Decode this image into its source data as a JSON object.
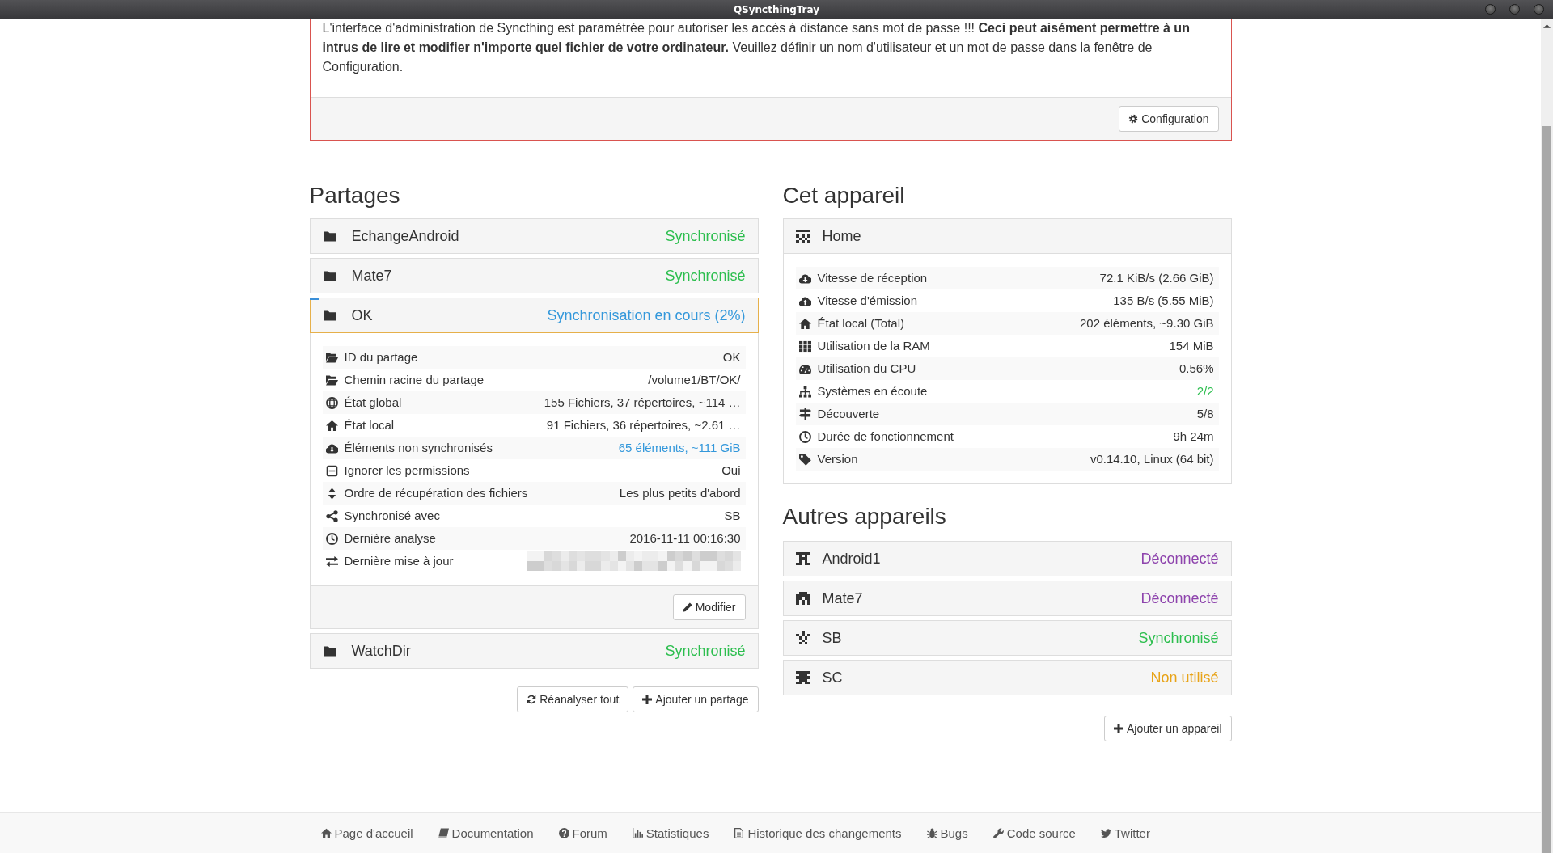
{
  "window": {
    "title": "QSyncthingTray"
  },
  "warning": {
    "message": "L'interface d'administration de Syncthing est paramétrée pour autoriser les accès à distance sans mot de passe !!! **Ceci peut aisément permettre à un intrus de lire et modifier n'importe quel fichier de votre ordinateur.** Veuillez définir un nom d'utilisateur et un mot de passe dans la fenêtre de Configuration.",
    "button": "Configuration"
  },
  "folders": {
    "title": "Partages",
    "items": [
      {
        "name": "EchangeAndroid",
        "status": "Synchronisé",
        "color": "#2cbe4e",
        "expanded": false
      },
      {
        "name": "Mate7",
        "status": "Synchronisé",
        "color": "#2cbe4e",
        "expanded": false
      },
      {
        "name": "OK",
        "status": "Synchronisation en cours (2%)",
        "color": "#3498db",
        "expanded": true,
        "level": 0.02,
        "details": [
          {
            "kind": "text",
            "label": "ID du partage",
            "value": "OK",
            "color": "#333333"
          },
          {
            "kind": "text",
            "label": "Chemin racine du partage",
            "value": "/volume1/BT/OK/",
            "color": "#333333"
          },
          {
            "kind": "text",
            "label": "État global",
            "value": "155 Fichiers, 37 répertoires, ~114 …",
            "color": "#333333"
          },
          {
            "kind": "text",
            "label": "État local",
            "value": "91 Fichiers, 36 répertoires, ~2.61 …",
            "color": "#333333"
          },
          {
            "kind": "link",
            "label": "Éléments non synchronisés",
            "value": "65 éléments, ~111 GiB",
            "color": "#3498db"
          },
          {
            "kind": "text",
            "label": "Ignorer les permissions",
            "value": "Oui",
            "color": "#333333"
          },
          {
            "kind": "text",
            "label": "Ordre de récupération des fichiers",
            "value": "Les plus petits d'abord",
            "color": "#333333"
          },
          {
            "kind": "text",
            "label": "Synchronisé avec",
            "value": "SB",
            "color": "#333333"
          },
          {
            "kind": "text",
            "label": "Dernière analyse",
            "value": "2016-11-11 00:16:30",
            "color": "#333333"
          },
          {
            "kind": "redacted",
            "label": "Dernière mise à jour"
          }
        ],
        "button": "Modifier"
      },
      {
        "name": "WatchDir",
        "status": "Synchronisé",
        "color": "#2cbe4e",
        "expanded": false
      }
    ],
    "buttons": [
      "Réanalyser tout",
      "Ajouter un partage"
    ]
  },
  "this_device": {
    "title": "Cet appareil",
    "name": "Home",
    "details": [
      {
        "label": "Vitesse de réception",
        "value": "72.1 KiB/s (2.66 GiB)",
        "color": "#333333"
      },
      {
        "label": "Vitesse d'émission",
        "value": "135 B/s (5.55 MiB)",
        "color": "#333333"
      },
      {
        "label": "État local (Total)",
        "value": "202 éléments, ~9.30 GiB",
        "color": "#333333"
      },
      {
        "label": "Utilisation de la RAM",
        "value": "154 MiB",
        "color": "#333333"
      },
      {
        "label": "Utilisation du CPU",
        "value": "0.56%",
        "color": "#333333"
      },
      {
        "label": "Systèmes en écoute",
        "value": "2/2",
        "color": "#2cbe4e"
      },
      {
        "label": "Découverte",
        "value": "5/8",
        "color": "#333333"
      },
      {
        "label": "Durée de fonctionnement",
        "value": "9h 24m",
        "color": "#333333"
      },
      {
        "label": "Version",
        "value": "v0.14.10, Linux (64 bit)",
        "color": "#333333"
      }
    ]
  },
  "other_devices": {
    "title": "Autres appareils",
    "items": [
      {
        "name": "Android1",
        "status": "Déconnecté",
        "color": "#8e44ad"
      },
      {
        "name": "Mate7",
        "status": "Déconnecté",
        "color": "#8e44ad"
      },
      {
        "name": "SB",
        "status": "Synchronisé",
        "color": "#2cbe4e"
      },
      {
        "name": "SC",
        "status": "Non utilisé",
        "color": "#e8a317"
      }
    ],
    "button": "Ajouter un appareil"
  },
  "footer_links": [
    "Page d'accueil",
    "Documentation",
    "Forum",
    "Statistiques",
    "Historique des changements",
    "Bugs",
    "Code source",
    "Twitter"
  ]
}
